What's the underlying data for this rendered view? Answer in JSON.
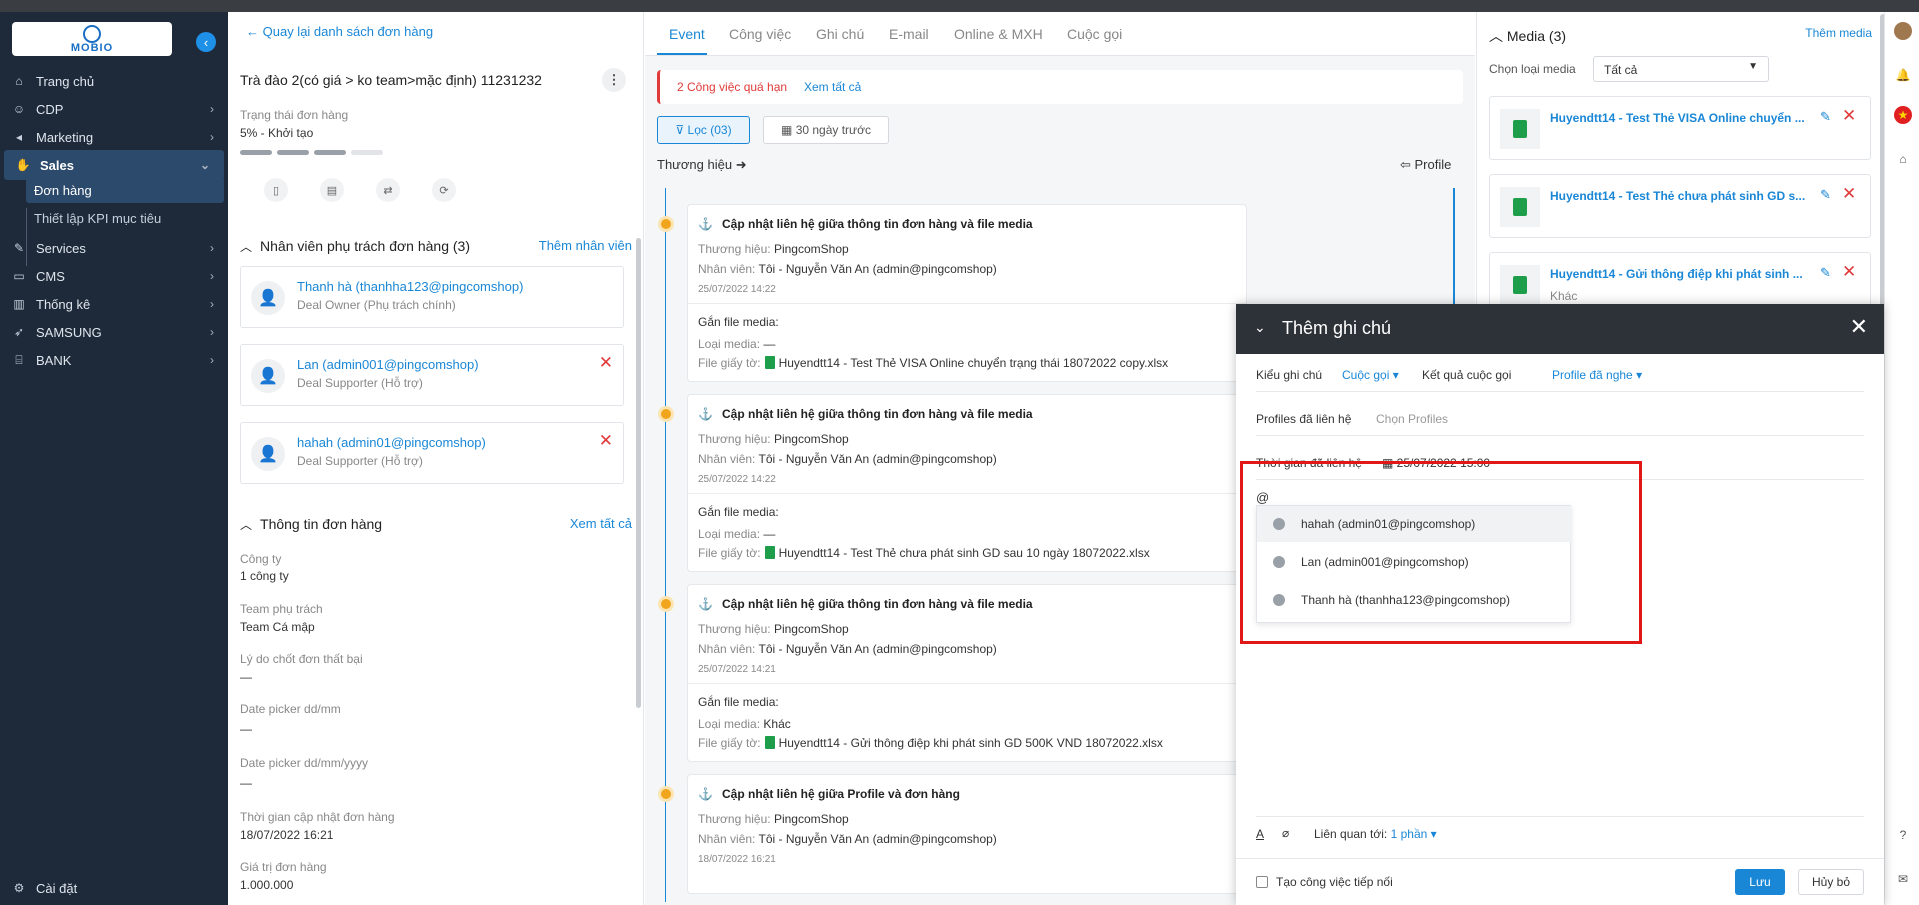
{
  "app": {
    "logo_text": "MOBIO",
    "collapse_icon": "chevron-left-icon"
  },
  "sidebar": {
    "items": [
      {
        "label": "Trang chủ",
        "icon": "home-icon"
      },
      {
        "label": "CDP",
        "icon": "user-icon"
      },
      {
        "label": "Marketing",
        "icon": "megaphone-icon"
      },
      {
        "label": "Sales",
        "icon": "handshake-icon"
      },
      {
        "label": "Services",
        "icon": "wrench-icon"
      },
      {
        "label": "CMS",
        "icon": "cms-icon"
      },
      {
        "label": "Thống kê",
        "icon": "chart-icon"
      },
      {
        "label": "SAMSUNG",
        "icon": "rocket-icon"
      },
      {
        "label": "BANK",
        "icon": "bank-icon"
      }
    ],
    "sales_sub": [
      "Đơn hàng",
      "Thiết lập KPI mục tiêu"
    ],
    "settings": "Cài đặt"
  },
  "detail": {
    "back": "Quay lại danh sách đơn hàng",
    "title": "Trà đào 2(có giá > ko team>mặc định) 11231232",
    "status_label": "Trạng thái đơn hàng",
    "status_value": "5% - Khởi tạo",
    "progress_steps_filled": 3,
    "progress_steps_total": 5,
    "staff_section": "Nhân viên phụ trách đơn hàng (3)",
    "add_staff": "Thêm nhân viên",
    "staff": [
      {
        "name": "Thanh hà (thanhha123@pingcomshop)",
        "role": "Deal Owner (Phụ trách chính)"
      },
      {
        "name": "Lan (admin001@pingcomshop)",
        "role": "Deal Supporter (Hỗ trợ)"
      },
      {
        "name": "hahah (admin01@pingcomshop)",
        "role": "Deal Supporter (Hỗ trợ)"
      }
    ],
    "info_section": "Thông tin đơn hàng",
    "see_all": "Xem tất cả",
    "fields": [
      {
        "label": "Công ty",
        "value": "1 công ty"
      },
      {
        "label": "Team phụ trách",
        "value": "Team Cá mập"
      },
      {
        "label": "Lý do chốt đơn thất bại",
        "value": "—"
      },
      {
        "label": "Date picker dd/mm",
        "value": "—"
      },
      {
        "label": "Date picker dd/mm/yyyy",
        "value": "—"
      },
      {
        "label": "Thời gian cập nhật đơn hàng",
        "value": "18/07/2022 16:21"
      },
      {
        "label": "Giá trị đơn hàng",
        "value": "1.000.000"
      }
    ]
  },
  "tabs": [
    "Event",
    "Công việc",
    "Ghi chú",
    "E-mail",
    "Online & MXH",
    "Cuộc gọi"
  ],
  "alert": {
    "text": "2 Công việc quá hạn",
    "link": "Xem tất cả"
  },
  "filter": {
    "label": "Lọc (03)",
    "date": "30 ngày trước"
  },
  "timeline": {
    "left": "Thương hiệu",
    "right": "Profile",
    "events": [
      {
        "title": "Cập nhật liên hệ giữa thông tin đơn hàng và file media",
        "brand_label": "Thương hiệu:",
        "brand": "PingcomShop",
        "staff_label": "Nhân viên:",
        "staff": "Tôi - Nguyễn Văn An (admin@pingcomshop)",
        "time": "25/07/2022 14:22",
        "attach": "Gắn file media:",
        "type_label": "Loại media:",
        "type": "—",
        "file_label": "File giấy tờ:",
        "file": "Huyendtt14 - Test Thẻ VISA Online chuyển trạng thái 18072022 copy.xlsx"
      },
      {
        "title": "Cập nhật liên hệ giữa thông tin đơn hàng và file media",
        "brand_label": "Thương hiệu:",
        "brand": "PingcomShop",
        "staff_label": "Nhân viên:",
        "staff": "Tôi - Nguyễn Văn An (admin@pingcomshop)",
        "time": "25/07/2022 14:22",
        "attach": "Gắn file media:",
        "type_label": "Loại media:",
        "type": "—",
        "file_label": "File giấy tờ:",
        "file": "Huyendtt14 - Test Thẻ chưa phát sinh GD sau 10 ngày 18072022.xlsx"
      },
      {
        "title": "Cập nhật liên hệ giữa thông tin đơn hàng và file media",
        "brand_label": "Thương hiệu:",
        "brand": "PingcomShop",
        "staff_label": "Nhân viên:",
        "staff": "Tôi - Nguyễn Văn An (admin@pingcomshop)",
        "time": "25/07/2022 14:21",
        "attach": "Gắn file media:",
        "type_label": "Loại media:",
        "type": "Khác",
        "file_label": "File giấy tờ:",
        "file": "Huyendtt14 - Gửi thông điệp khi phát sinh GD 500K VND 18072022.xlsx"
      },
      {
        "title": "Cập nhật liên hệ giữa Profile và đơn hàng",
        "brand_label": "Thương hiệu:",
        "brand": "PingcomShop",
        "staff_label": "Nhân viên:",
        "staff": "Tôi - Nguyễn Văn An (admin@pingcomshop)",
        "time": "18/07/2022 16:21"
      }
    ]
  },
  "media": {
    "title": "Media (3)",
    "add": "Thêm media",
    "type_label": "Chọn loại media",
    "type_value": "Tất cả",
    "files": [
      {
        "name": "Huyendtt14 - Test Thẻ VISA Online chuyển ...",
        "sub": ""
      },
      {
        "name": "Huyendtt14 - Test Thẻ chưa phát sinh GD s...",
        "sub": ""
      },
      {
        "name": "Huyendtt14 - Gửi thông điệp khi phát sinh ...",
        "sub": "Khác"
      }
    ]
  },
  "note_modal": {
    "title": "Thêm ghi chú",
    "type_label": "Kiểu ghi chú",
    "type_value": "Cuộc gọi",
    "result_label": "Kết quả cuộc gọi",
    "result_value": "Profile đã nghe",
    "profiles_label": "Profiles đã liên hệ",
    "profiles_placeholder": "Chọn Profiles",
    "time_label": "Thời gian đã liên hệ",
    "time_value": "25/07/2022 15:00",
    "input_text": "@",
    "mentions": [
      "hahah (admin01@pingcomshop)",
      "Lan (admin001@pingcomshop)",
      "Thanh hà (thanhha123@pingcomshop)"
    ],
    "related_label": "Liên quan tới:",
    "related_value": "1 phần",
    "next_task": "Tạo công việc tiếp nối",
    "save": "Lưu",
    "cancel": "Hủy bỏ"
  },
  "colors": {
    "accent": "#1a87d6",
    "sidebar": "#1e2a3a",
    "danger": "#e03a3a",
    "highlight_box": "#e01818"
  }
}
